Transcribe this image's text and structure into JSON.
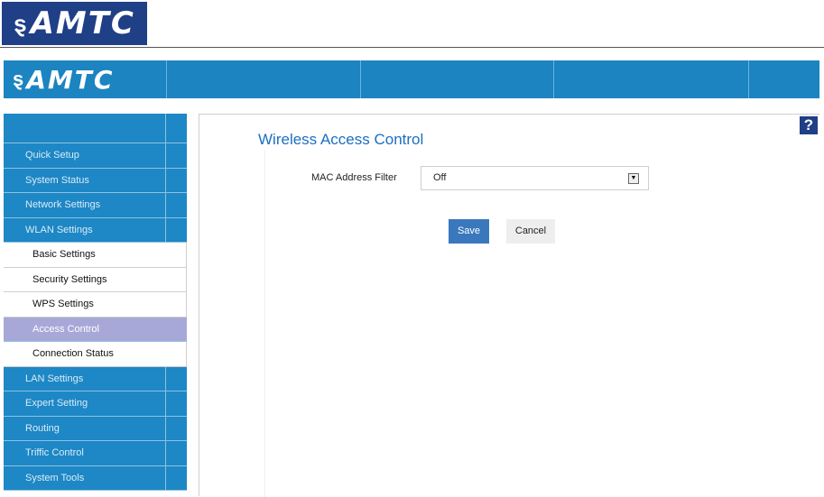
{
  "brand": {
    "logo_text": "AMTC",
    "logo_mark": "ȿ"
  },
  "sidebar": {
    "items": [
      {
        "label": "Quick Setup",
        "type": "main"
      },
      {
        "label": "System Status",
        "type": "main"
      },
      {
        "label": "Network Settings",
        "type": "main"
      },
      {
        "label": "WLAN Settings",
        "type": "main"
      },
      {
        "label": "Basic Settings",
        "type": "sub"
      },
      {
        "label": "Security Settings",
        "type": "sub"
      },
      {
        "label": "WPS Settings",
        "type": "sub"
      },
      {
        "label": "Access Control",
        "type": "active"
      },
      {
        "label": "Connection Status",
        "type": "sub"
      },
      {
        "label": "LAN Settings",
        "type": "main"
      },
      {
        "label": "Expert Setting",
        "type": "main"
      },
      {
        "label": "Routing",
        "type": "main"
      },
      {
        "label": "Triffic Control",
        "type": "main"
      },
      {
        "label": "System Tools",
        "type": "main"
      }
    ]
  },
  "main": {
    "title": "Wireless Access Control",
    "help_label": "?",
    "mac_filter": {
      "label": "MAC Address Filter",
      "value": "Off"
    },
    "save_label": "Save",
    "cancel_label": "Cancel"
  },
  "colors": {
    "header": "#1c84c0",
    "sidebar": "#1e87c5",
    "active": "#a8a8d8",
    "title": "#1b6fc0",
    "save": "#3a78bd",
    "logo_bg": "#1f3f86"
  },
  "icons": {
    "help": "help-icon",
    "dropdown": "chevron-down-icon"
  }
}
